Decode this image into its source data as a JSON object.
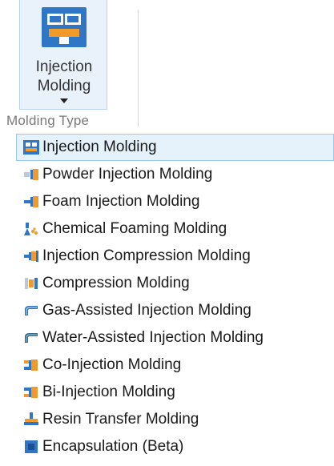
{
  "ribbon": {
    "button_label_line1": "Injection",
    "button_label_line2": "Molding",
    "group_label": "Molding Type"
  },
  "menu": {
    "items": [
      {
        "label": "Injection Molding",
        "icon": "injection-molding-icon",
        "selected": true
      },
      {
        "label": "Powder Injection Molding",
        "icon": "powder-injection-icon"
      },
      {
        "label": "Foam Injection Molding",
        "icon": "foam-injection-icon"
      },
      {
        "label": "Chemical Foaming Molding",
        "icon": "chemical-foaming-icon"
      },
      {
        "label": "Injection Compression Molding",
        "icon": "injection-compression-icon"
      },
      {
        "label": "Compression Molding",
        "icon": "compression-molding-icon"
      },
      {
        "label": "Gas-Assisted Injection Molding",
        "icon": "gas-assisted-icon"
      },
      {
        "label": "Water-Assisted Injection Molding",
        "icon": "water-assisted-icon"
      },
      {
        "label": "Co-Injection Molding",
        "icon": "co-injection-icon"
      },
      {
        "label": "Bi-Injection Molding",
        "icon": "bi-injection-icon"
      },
      {
        "label": "Resin Transfer Molding",
        "icon": "resin-transfer-icon"
      },
      {
        "label": "Encapsulation (Beta)",
        "icon": "encapsulation-icon"
      }
    ]
  },
  "colors": {
    "accent_blue": "#2f76c7",
    "orange": "#f09a2a",
    "selected_bg": "#e5f1fb"
  }
}
